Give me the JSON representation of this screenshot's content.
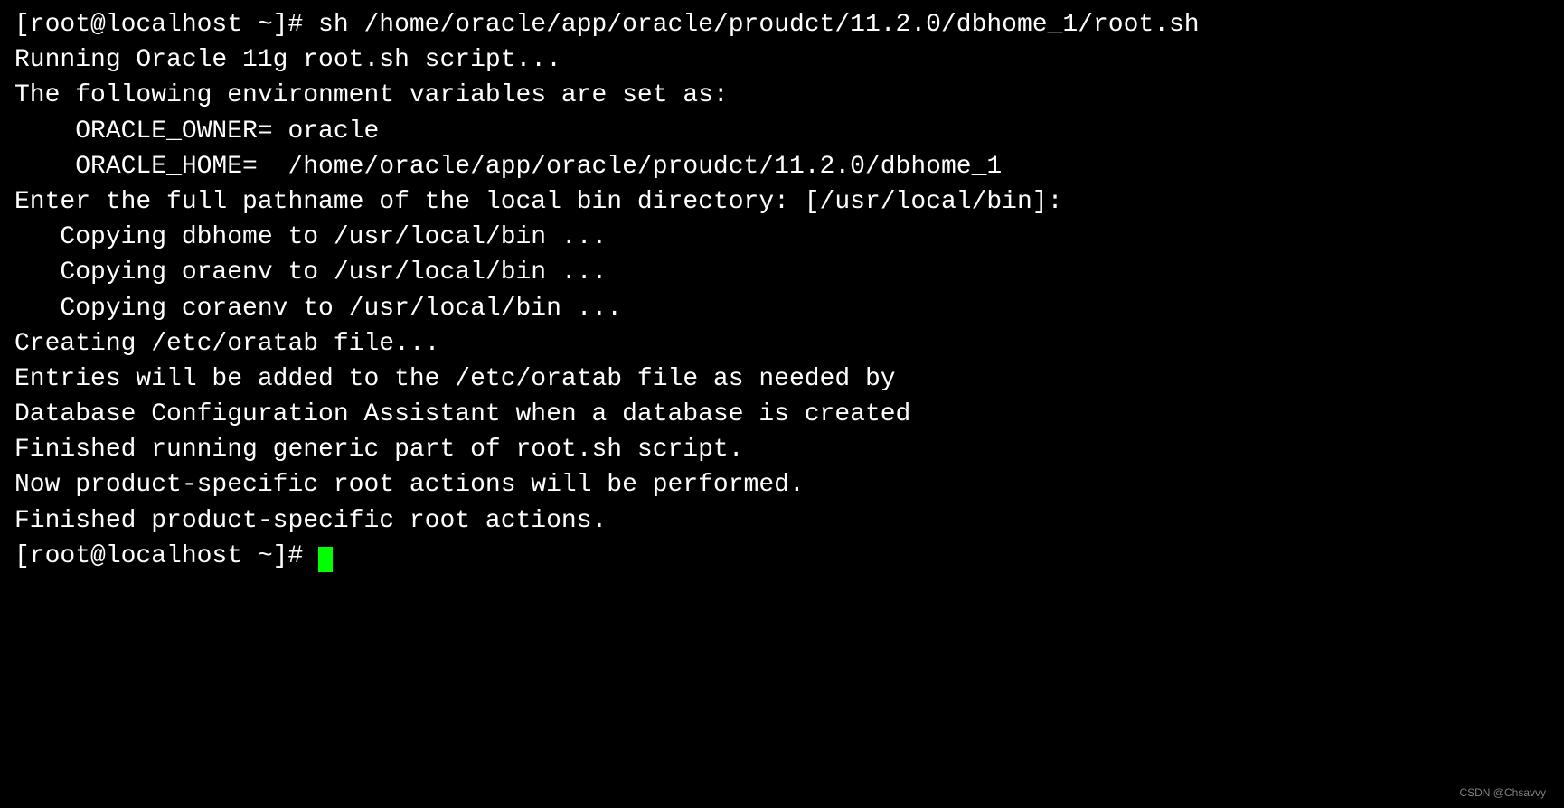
{
  "terminal": {
    "lines": [
      "[root@localhost ~]# sh /home/oracle/app/oracle/proudct/11.2.0/dbhome_1/root.sh",
      "Running Oracle 11g root.sh script...",
      "",
      "The following environment variables are set as:",
      "    ORACLE_OWNER= oracle",
      "    ORACLE_HOME=  /home/oracle/app/oracle/proudct/11.2.0/dbhome_1",
      "",
      "Enter the full pathname of the local bin directory: [/usr/local/bin]: ",
      "   Copying dbhome to /usr/local/bin ...",
      "   Copying oraenv to /usr/local/bin ...",
      "   Copying coraenv to /usr/local/bin ...",
      "",
      "",
      "Creating /etc/oratab file...",
      "Entries will be added to the /etc/oratab file as needed by",
      "Database Configuration Assistant when a database is created",
      "Finished running generic part of root.sh script.",
      "Now product-specific root actions will be performed.",
      "Finished product-specific root actions."
    ],
    "prompt_final": "[root@localhost ~]# "
  },
  "watermark": "CSDN @Chsavvy"
}
